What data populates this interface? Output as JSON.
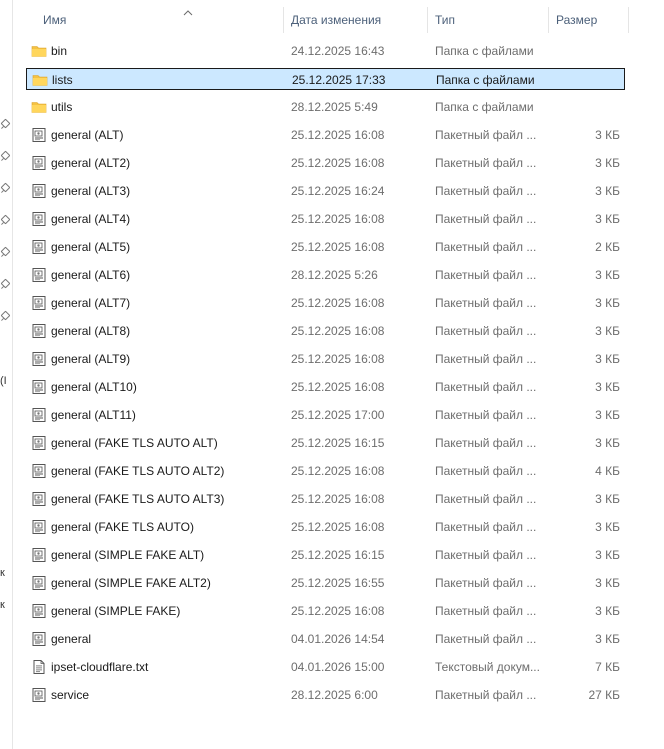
{
  "columns": {
    "name": "Имя",
    "date": "Дата изменения",
    "type": "Тип",
    "size": "Размер"
  },
  "side_fragments": [
    "(I",
    "к",
    "к"
  ],
  "colors": {
    "selection": "#cce8ff",
    "folder": "#f5c243",
    "header_text": "#4c607a"
  },
  "files": [
    {
      "name": "bin",
      "date": "24.12.2025 16:43",
      "type": "Папка с файлами",
      "size": "",
      "icon": "folder-icon"
    },
    {
      "name": "lists",
      "date": "25.12.2025 17:33",
      "type": "Папка с файлами",
      "size": "",
      "icon": "folder-icon",
      "selected": true
    },
    {
      "name": "utils",
      "date": "28.12.2025 5:49",
      "type": "Папка с файлами",
      "size": "",
      "icon": "folder-icon"
    },
    {
      "name": "general (ALT)",
      "date": "25.12.2025 16:08",
      "type": "Пакетный файл ...",
      "size": "3 КБ",
      "icon": "batch-file-icon"
    },
    {
      "name": "general (ALT2)",
      "date": "25.12.2025 16:08",
      "type": "Пакетный файл ...",
      "size": "3 КБ",
      "icon": "batch-file-icon"
    },
    {
      "name": "general (ALT3)",
      "date": "25.12.2025 16:24",
      "type": "Пакетный файл ...",
      "size": "3 КБ",
      "icon": "batch-file-icon"
    },
    {
      "name": "general (ALT4)",
      "date": "25.12.2025 16:08",
      "type": "Пакетный файл ...",
      "size": "3 КБ",
      "icon": "batch-file-icon"
    },
    {
      "name": "general (ALT5)",
      "date": "25.12.2025 16:08",
      "type": "Пакетный файл ...",
      "size": "2 КБ",
      "icon": "batch-file-icon"
    },
    {
      "name": "general (ALT6)",
      "date": "28.12.2025 5:26",
      "type": "Пакетный файл ...",
      "size": "3 КБ",
      "icon": "batch-file-icon"
    },
    {
      "name": "general (ALT7)",
      "date": "25.12.2025 16:08",
      "type": "Пакетный файл ...",
      "size": "3 КБ",
      "icon": "batch-file-icon"
    },
    {
      "name": "general (ALT8)",
      "date": "25.12.2025 16:08",
      "type": "Пакетный файл ...",
      "size": "3 КБ",
      "icon": "batch-file-icon"
    },
    {
      "name": "general (ALT9)",
      "date": "25.12.2025 16:08",
      "type": "Пакетный файл ...",
      "size": "3 КБ",
      "icon": "batch-file-icon"
    },
    {
      "name": "general (ALT10)",
      "date": "25.12.2025 16:08",
      "type": "Пакетный файл ...",
      "size": "3 КБ",
      "icon": "batch-file-icon"
    },
    {
      "name": "general (ALT11)",
      "date": "25.12.2025 17:00",
      "type": "Пакетный файл ...",
      "size": "3 КБ",
      "icon": "batch-file-icon"
    },
    {
      "name": "general (FAKE TLS AUTO ALT)",
      "date": "25.12.2025 16:15",
      "type": "Пакетный файл ...",
      "size": "3 КБ",
      "icon": "batch-file-icon"
    },
    {
      "name": "general (FAKE TLS AUTO ALT2)",
      "date": "25.12.2025 16:08",
      "type": "Пакетный файл ...",
      "size": "4 КБ",
      "icon": "batch-file-icon"
    },
    {
      "name": "general (FAKE TLS AUTO ALT3)",
      "date": "25.12.2025 16:08",
      "type": "Пакетный файл ...",
      "size": "3 КБ",
      "icon": "batch-file-icon"
    },
    {
      "name": "general (FAKE TLS AUTO)",
      "date": "25.12.2025 16:08",
      "type": "Пакетный файл ...",
      "size": "3 КБ",
      "icon": "batch-file-icon"
    },
    {
      "name": "general (SIMPLE FAKE ALT)",
      "date": "25.12.2025 16:15",
      "type": "Пакетный файл ...",
      "size": "3 КБ",
      "icon": "batch-file-icon"
    },
    {
      "name": "general (SIMPLE FAKE ALT2)",
      "date": "25.12.2025 16:55",
      "type": "Пакетный файл ...",
      "size": "3 КБ",
      "icon": "batch-file-icon"
    },
    {
      "name": "general (SIMPLE FAKE)",
      "date": "25.12.2025 16:08",
      "type": "Пакетный файл ...",
      "size": "3 КБ",
      "icon": "batch-file-icon"
    },
    {
      "name": "general",
      "date": "04.01.2026 14:54",
      "type": "Пакетный файл ...",
      "size": "3 КБ",
      "icon": "batch-file-icon"
    },
    {
      "name": "ipset-cloudflare.txt",
      "date": "04.01.2026 15:00",
      "type": "Текстовый докум...",
      "size": "7 КБ",
      "icon": "text-file-icon"
    },
    {
      "name": "service",
      "date": "28.12.2025 6:00",
      "type": "Пакетный файл ...",
      "size": "27 КБ",
      "icon": "batch-file-icon"
    }
  ]
}
